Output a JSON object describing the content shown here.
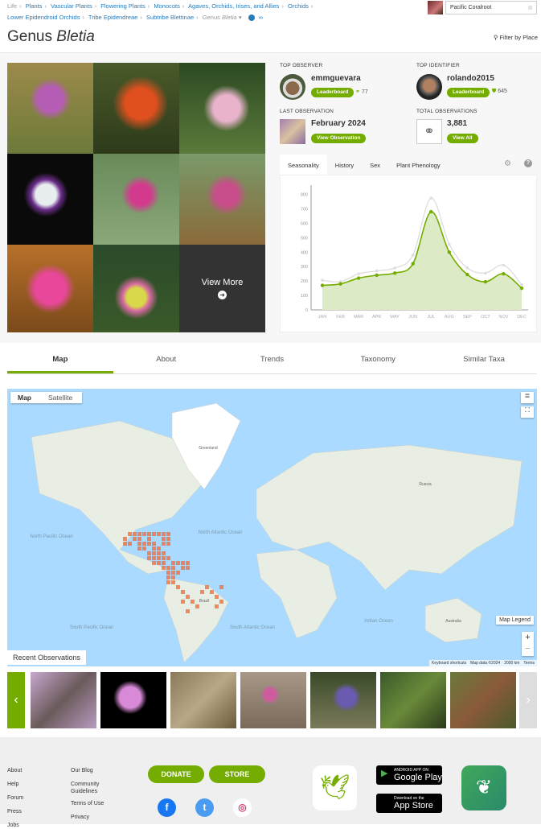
{
  "breadcrumbs": [
    "Life",
    "Plants",
    "Vascular Plants",
    "Flowering Plants",
    "Monocots",
    "Agaves, Orchids, Irises, and Allies",
    "Orchids",
    "Lower Epidendroid Orchids",
    "Tribe Epidendreae",
    "Subtribe Blettinae"
  ],
  "breadcrumb_current": {
    "rank": "Genus",
    "name": "Bletia"
  },
  "place_search": {
    "value": "Pacific Coralroot",
    "clear_icon": "clear-icon"
  },
  "title": {
    "rank": "Genus",
    "name": "Bletia"
  },
  "filter_by_place": "Filter by Place",
  "photos": {
    "view_more": "View More"
  },
  "top_observer": {
    "label": "TOP OBSERVER",
    "user": "emmguevara",
    "button": "Leaderboard",
    "count": "77"
  },
  "top_identifier": {
    "label": "TOP IDENTIFIER",
    "user": "rolando2015",
    "button": "Leaderboard",
    "count": "645"
  },
  "last_observation": {
    "label": "LAST OBSERVATION",
    "date": "February 2024",
    "button": "View Observation"
  },
  "total_observations": {
    "label": "TOTAL OBSERVATIONS",
    "count": "3,881",
    "button": "View All"
  },
  "chart_tabs": [
    "Seasonality",
    "History",
    "Sex",
    "Plant Phenology"
  ],
  "chart_data": {
    "type": "area",
    "categories": [
      "JAN",
      "FEB",
      "MAR",
      "APR",
      "MAY",
      "JUN",
      "JUL",
      "AUG",
      "SEP",
      "OCT",
      "NOV",
      "DEC"
    ],
    "series": [
      {
        "values": [
          170,
          180,
          220,
          240,
          255,
          320,
          680,
          400,
          245,
          195,
          250,
          150
        ],
        "color": "#74ac00"
      },
      {
        "values": [
          205,
          195,
          250,
          270,
          290,
          380,
          775,
          455,
          290,
          255,
          310,
          175
        ],
        "color": "#dddddd"
      }
    ],
    "yticks": [
      0,
      100,
      200,
      300,
      400,
      500,
      600,
      700,
      800
    ],
    "ylim": [
      0,
      820
    ],
    "grid": false
  },
  "main_tabs": [
    "Map",
    "About",
    "Trends",
    "Taxonomy",
    "Similar Taxa"
  ],
  "map": {
    "type_buttons": [
      "Map",
      "Satellite"
    ],
    "legend": "Map Legend",
    "labels": [
      "Greenland",
      "North Atlantic Ocean",
      "North Pacific Ocean",
      "South Atlantic Ocean",
      "South Pacific Ocean",
      "Indian Ocean",
      "Australia",
      "Brazil",
      "Russia"
    ],
    "attribution": [
      "Keyboard shortcuts",
      "Map data ©2024",
      "2000 km",
      "Terms"
    ],
    "zoom_in": "+",
    "zoom_out": "−"
  },
  "recent_observations": {
    "label": "Recent Observations"
  },
  "footer": {
    "col1": [
      "About",
      "Help",
      "Forum",
      "Press",
      "Jobs"
    ],
    "col2": [
      "Our Blog",
      "Community Guidelines",
      "Terms of Use",
      "Privacy"
    ],
    "donate": "DONATE",
    "store": "STORE",
    "google_play": {
      "small": "ANDROID APP ON",
      "big": "Google Play"
    },
    "app_store": {
      "small": "Download on the",
      "big": "App Store"
    }
  },
  "colors": {
    "accent": "#74ac00",
    "link": "#2b7bb9"
  }
}
